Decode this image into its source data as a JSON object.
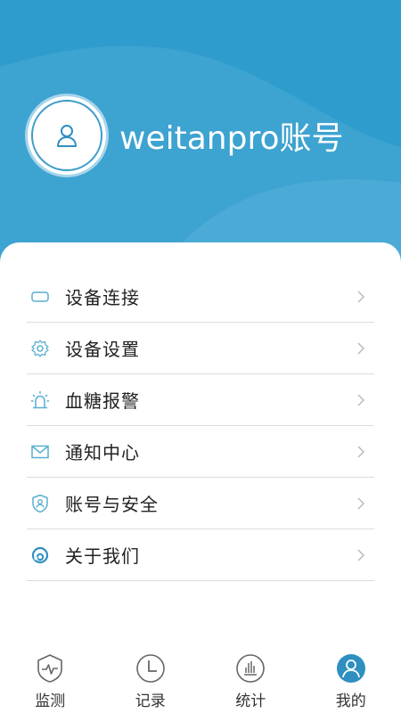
{
  "profile": {
    "account_name": "weitanpro账号"
  },
  "menu": {
    "items": [
      {
        "label": "设备连接",
        "icon": "device-icon"
      },
      {
        "label": "设备设置",
        "icon": "gear-icon"
      },
      {
        "label": "血糖报警",
        "icon": "alarm-icon"
      },
      {
        "label": "通知中心",
        "icon": "envelope-icon"
      },
      {
        "label": "账号与安全",
        "icon": "shield-icon"
      },
      {
        "label": "关于我们",
        "icon": "info-icon"
      }
    ]
  },
  "tabbar": {
    "tabs": [
      {
        "label": "监测",
        "icon": "heart-monitor-icon",
        "active": false
      },
      {
        "label": "记录",
        "icon": "clock-icon",
        "active": false
      },
      {
        "label": "统计",
        "icon": "bar-chart-icon",
        "active": false
      },
      {
        "label": "我的",
        "icon": "user-icon",
        "active": true
      }
    ]
  },
  "colors": {
    "header_bg": "#2e9ccc",
    "accent": "#2e8fc0",
    "icon_stroke": "#5aaed0",
    "divider": "#dcdcdc"
  }
}
